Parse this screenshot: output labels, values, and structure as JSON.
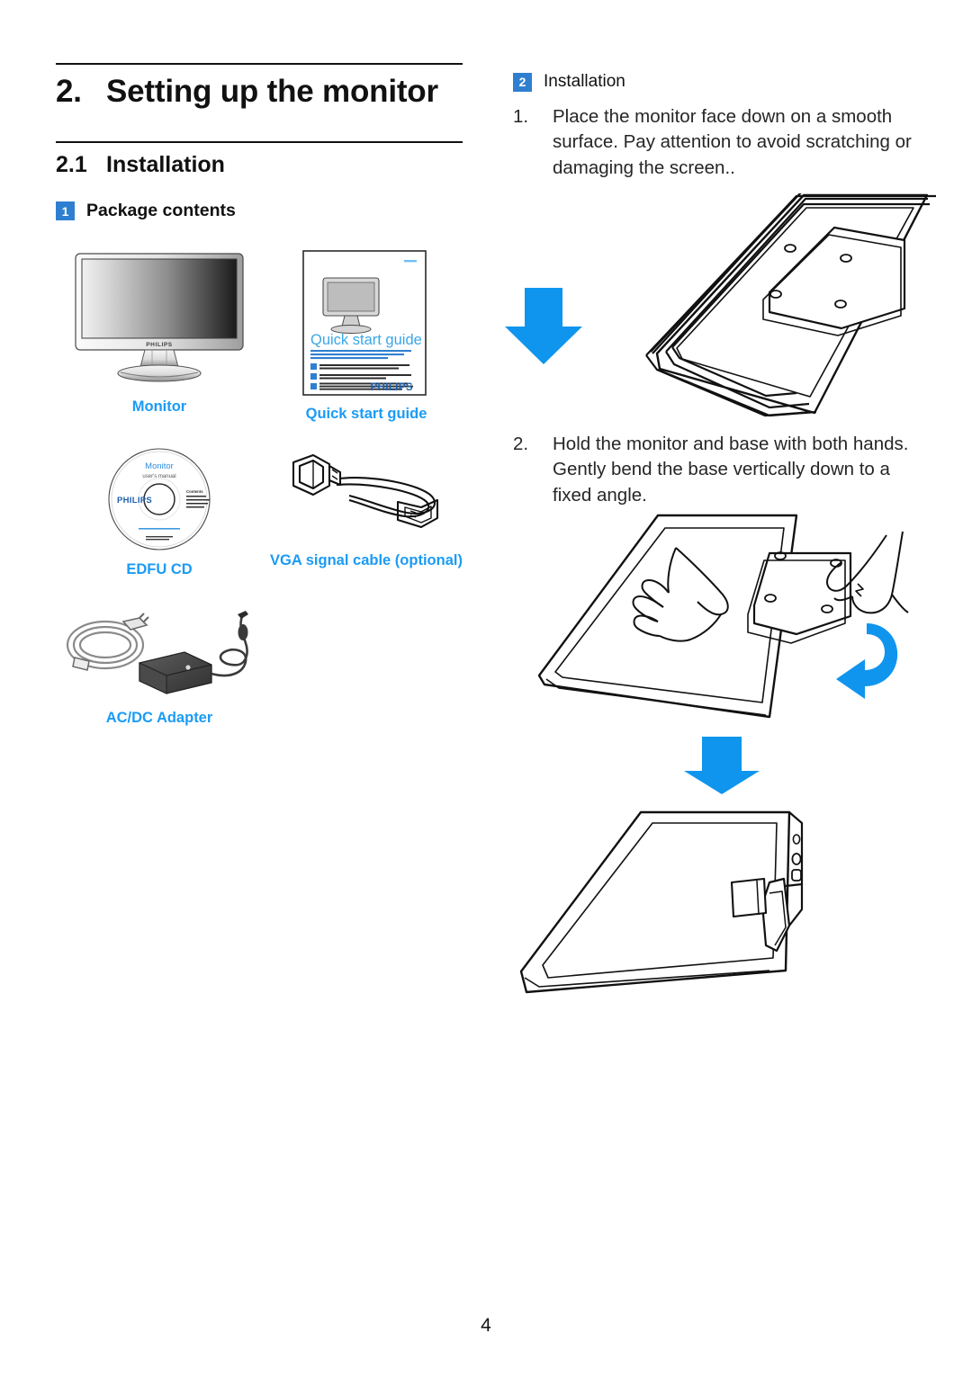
{
  "document": {
    "page_number": "4",
    "accent_blue": "#1b9bf5",
    "badge_blue": "#2f7fd1",
    "arrow_blue": "#0f95ee"
  },
  "left": {
    "chapter": {
      "number": "2.",
      "title": "Setting up the monitor"
    },
    "section": {
      "number": "2.1",
      "title": "Installation"
    },
    "subsection": {
      "badge": "1",
      "title": "Package contents"
    },
    "package_items": [
      {
        "caption": "Monitor",
        "art": "monitor-front"
      },
      {
        "caption": "Quick start guide",
        "art": "quick-start-guide-booklet"
      },
      {
        "caption": "EDFU CD",
        "art": "cd-disc"
      },
      {
        "caption": "VGA signal cable (optional)",
        "art": "vga-cable"
      },
      {
        "caption": "AC/DC Adapter",
        "art": "ac-dc-adapter"
      }
    ],
    "monitor_art": {
      "brand": "PHILIPS"
    },
    "booklet_art": {
      "title": "Quick start guide",
      "brand": "PHILIPS",
      "badges": [
        "1",
        "2",
        "3"
      ]
    },
    "cd_art": {
      "title": "Monitor",
      "subtitle": "user's manual",
      "brand": "PHILIPS",
      "contents_label": "Contents"
    }
  },
  "right": {
    "subsection": {
      "badge": "2",
      "title": "Installation"
    },
    "steps": [
      {
        "number": "1.",
        "text": "Place the monitor face down on a smooth surface. Pay attention to avoid scratching or damaging the screen.."
      },
      {
        "number": "2.",
        "text": "Hold the monitor and base with both hands. Gently bend the base vertically down to a fixed angle."
      }
    ],
    "figures": [
      {
        "name": "monitor-face-down-with-down-arrow"
      },
      {
        "name": "hands-bending-base-with-curved-arrow"
      },
      {
        "name": "monitor-base-folded-with-down-arrow"
      }
    ]
  }
}
